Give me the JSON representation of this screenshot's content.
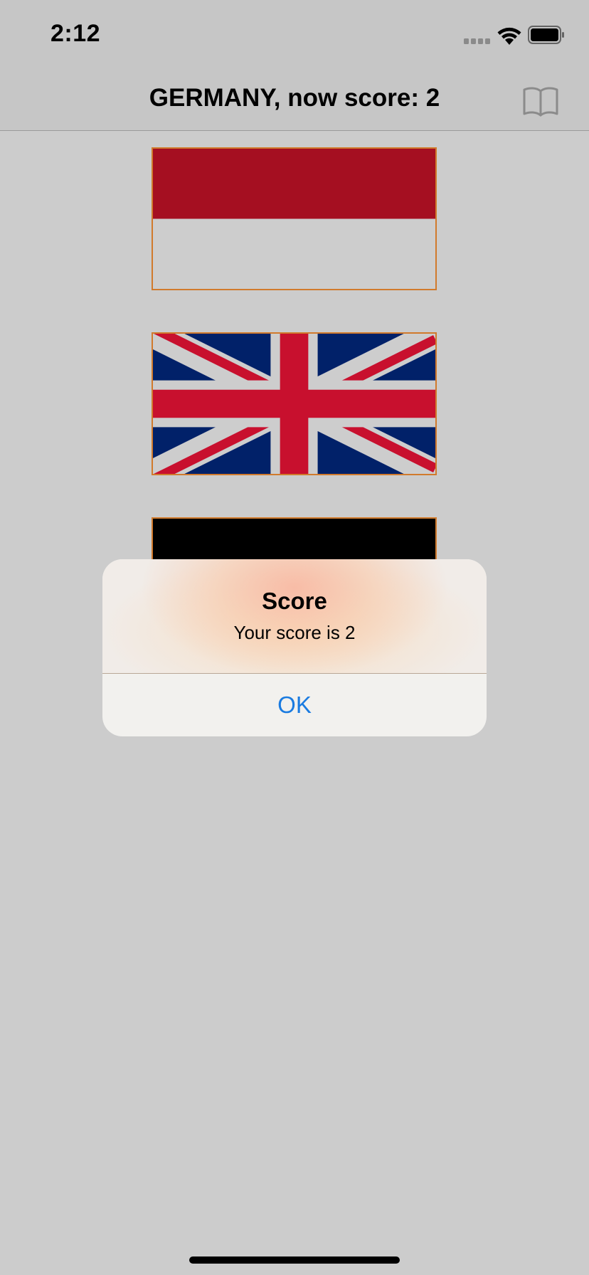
{
  "status_bar": {
    "time": "2:12",
    "icons": [
      "signal-icon",
      "wifi-icon",
      "battery-icon"
    ]
  },
  "nav": {
    "title": "GERMANY, now score: 2",
    "right_button_icon": "book-icon"
  },
  "flags": [
    {
      "name": "indonesia-monaco",
      "colors": [
        "#a50f21",
        "#cdcdcd"
      ]
    },
    {
      "name": "united-kingdom",
      "colors": [
        "#012169",
        "#c8102e",
        "#cdcdcd"
      ]
    },
    {
      "name": "germany-partial",
      "colors": [
        "#000000"
      ]
    }
  ],
  "alert": {
    "title": "Score",
    "message": "Your score is 2",
    "ok_label": "OK"
  },
  "colors": {
    "background": "#cccccc",
    "accent": "#1a7be0",
    "flag_border": "#d17a2c"
  }
}
